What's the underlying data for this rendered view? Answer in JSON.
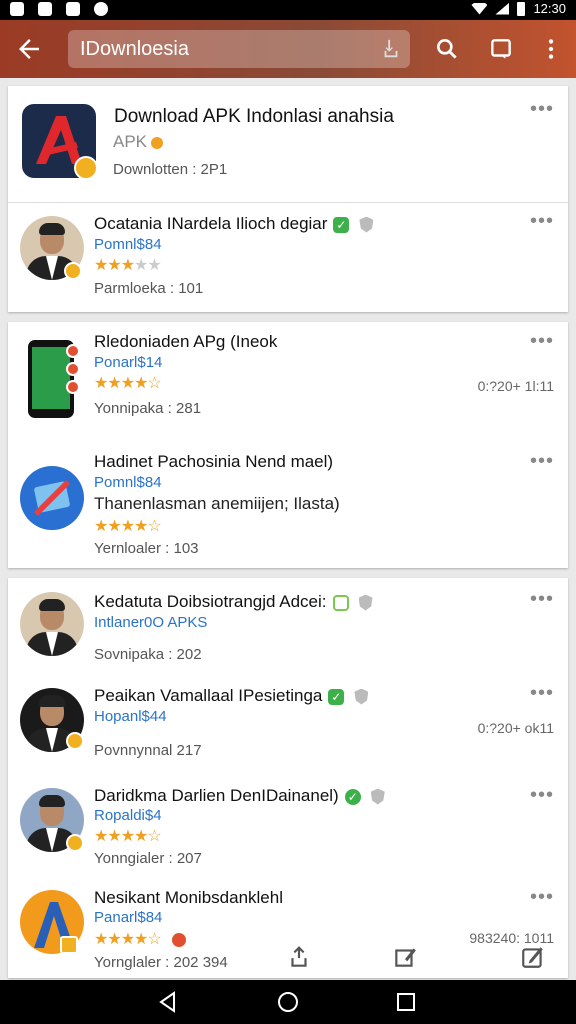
{
  "status_bar": {
    "time": "12:30"
  },
  "app_bar": {
    "search_value": "IDownloesia"
  },
  "featured": {
    "title": "Download APK Indonlasi anahsia",
    "subtitle": "APK",
    "meta": "Downlotten : 2P1",
    "more": "•••"
  },
  "card1_items": [
    {
      "title": "Ocatania INardela Ilioch degiar",
      "source": "Pomnl$84",
      "rating": 3,
      "meta": "Parmloeka : 101",
      "more": "•••"
    }
  ],
  "card2_items": [
    {
      "title": "Rledoniaden APg (Ineok",
      "source": "Ponarl$14",
      "rating": 4,
      "meta": "Yonnipaka : 281",
      "time": "0:?20+ 1l:11",
      "more": "•••"
    },
    {
      "title": "Hadinet Pachosinia Nend mael)",
      "source": "Pomnl$84",
      "desc": "Thanenlasman anemiijen; Ilasta)",
      "rating": 4,
      "meta": "Yernloaler : 103",
      "more": "•••"
    }
  ],
  "card3_items": [
    {
      "title": "Kedatuta Doibsiotrangjd Adcei:",
      "source": "Intlaner0O APKS",
      "meta": "Sovnipaka : 202",
      "more": "•••"
    },
    {
      "title": "Peaikan Vamallaal IPesietinga",
      "source": "Hopanl$44",
      "meta": "Povnnynnal      217",
      "time": "0:?20+ ok11",
      "more": "•••"
    },
    {
      "title": "Daridkma Darlien DenIDainanel)",
      "source": "Ropaldi$4",
      "rating": 4,
      "meta": "Yonngialer : 207",
      "more": "•••"
    },
    {
      "title": "Nesikant Monibsdanklehl",
      "source": "Panarl$84",
      "rating": 4,
      "meta": "Yornglaler : 202 394",
      "time": "983240: 1011",
      "more": "•••"
    }
  ],
  "icons": {
    "back": "arrow-left-icon",
    "search": "search-icon",
    "bookmark": "square-icon",
    "menu": "more-vertical-icon",
    "share": "share-icon",
    "edit": "edit-icon"
  },
  "colors": {
    "appbar": "#9b3b25",
    "accent_blue": "#2a73c9",
    "star": "#f0a020",
    "verified": "#3db04a"
  }
}
